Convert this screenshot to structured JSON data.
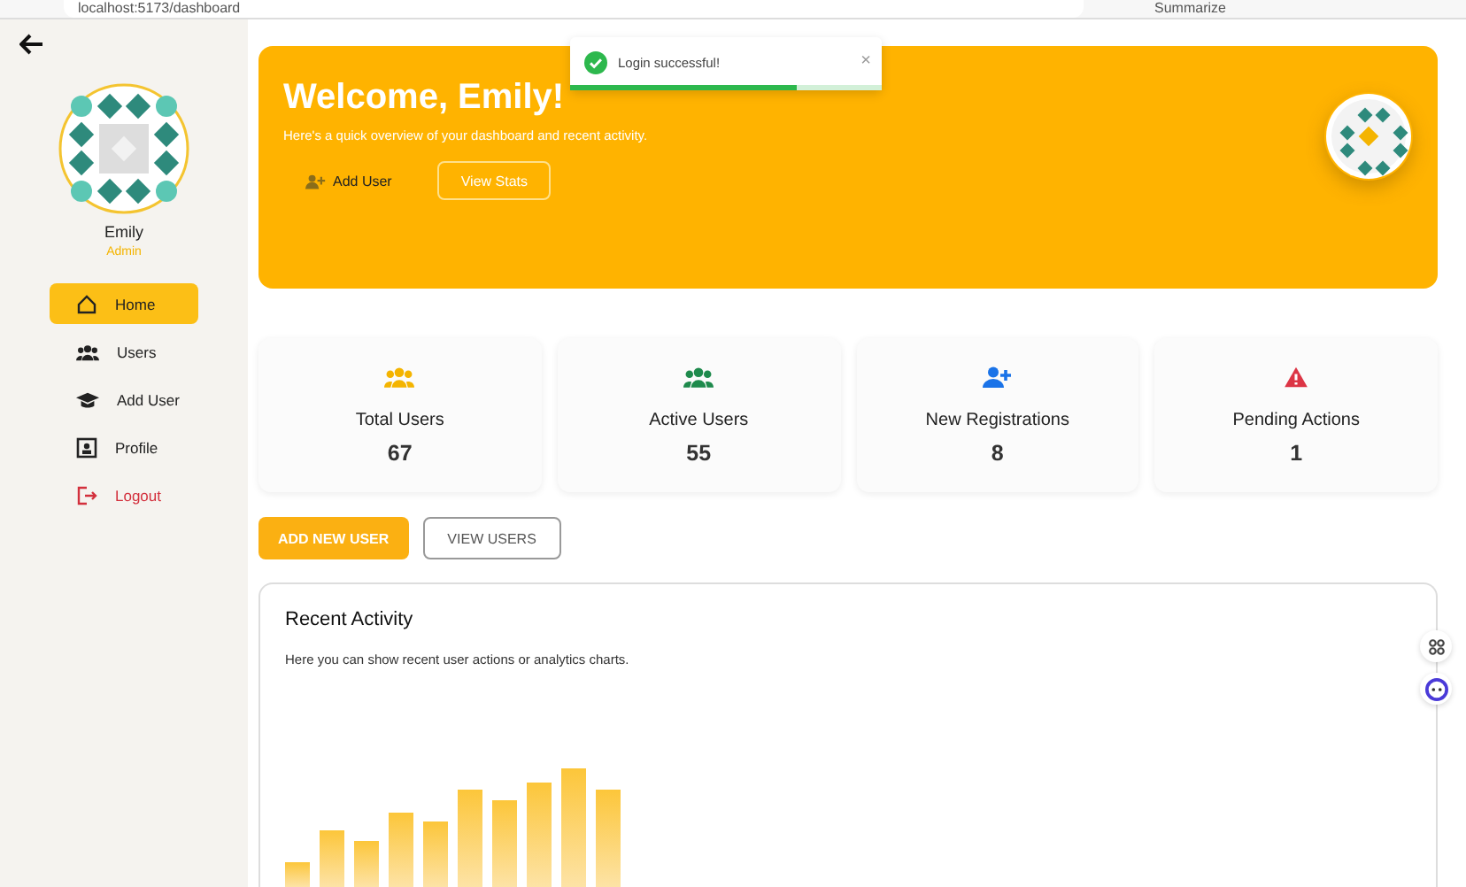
{
  "browser": {
    "address": "localhost:5173/dashboard",
    "summarize": "Summarize"
  },
  "sidebar": {
    "user": {
      "name": "Emily",
      "role": "Admin"
    },
    "items": [
      {
        "label": "Home",
        "selected": true,
        "kind": "home"
      },
      {
        "label": "Users",
        "selected": false,
        "kind": "users"
      },
      {
        "label": "Add User",
        "selected": false,
        "kind": "cap"
      },
      {
        "label": "Profile",
        "selected": false,
        "kind": "profile"
      },
      {
        "label": "Logout",
        "selected": false,
        "kind": "logout"
      }
    ]
  },
  "toast": {
    "message": "Login successful!",
    "close": "×",
    "level": 0.73
  },
  "hero": {
    "title": "Welcome, Emily!",
    "subtitle": "Here's a quick overview of your dashboard and recent activity.",
    "buttons": [
      {
        "label": "Add User",
        "kind": "ghost"
      },
      {
        "label": "View Stats",
        "kind": "outline"
      }
    ]
  },
  "stats": [
    {
      "label": "Total Users",
      "value": "67",
      "kind": "users",
      "color": "#f4b400"
    },
    {
      "label": "Active Users",
      "value": "55",
      "kind": "users",
      "color": "#1e8a4c"
    },
    {
      "label": "New Registrations",
      "value": "8",
      "kind": "adduser",
      "color": "#1a73e8"
    },
    {
      "label": "Pending Actions",
      "value": "1",
      "kind": "warning",
      "color": "#dc3545"
    }
  ],
  "actions": [
    {
      "label": "ADD NEW USER",
      "kind": "primary"
    },
    {
      "label": "VIEW USERS",
      "kind": "outline"
    }
  ],
  "activity": {
    "title": "Recent Activity",
    "text": "Here you can show recent user actions or analytics charts."
  }
}
